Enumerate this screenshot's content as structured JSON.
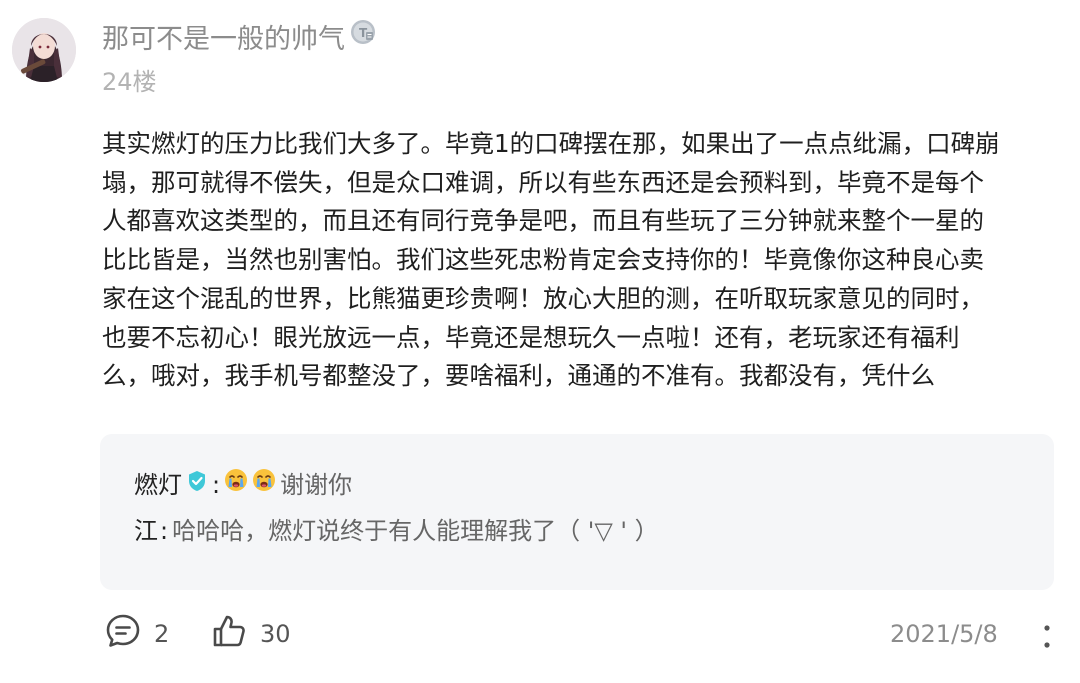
{
  "post": {
    "username": "那可不是一般的帅气",
    "floor": "24楼",
    "content_lines": [
      "其实燃灯的压力比我们大多了。毕竟1的口碑摆在那，如果出了一点点纰漏，口碑崩",
      "塌，那可就得不偿失，但是众口难调，所以有些东西还是会预料到，毕竟不是每个",
      "人都喜欢这类型的，而且还有同行竞争是吧，而且有些玩了三分钟就来整个一星的",
      "比比皆是，当然也别害怕。我们这些死忠粉肯定会支持你的！毕竟像你这种良心卖",
      "家在这个混乱的世界，比熊猫更珍贵啊！放心大胆的测，在听取玩家意见的同时，",
      "也要不忘初心！眼光放远一点，毕竟还是想玩久一点啦！还有，老玩家还有福利",
      "么，哦对，我手机号都整没了，要啥福利，通通的不准有。我都没有，凭什么"
    ]
  },
  "replies": [
    {
      "name": "燃灯",
      "separator": ":",
      "text": "谢谢你"
    },
    {
      "name": "江",
      "separator": ":",
      "text": "哈哈哈，燃灯说终于有人能理解我了（ '▽ ' ）"
    }
  ],
  "footer": {
    "comment_count": "2",
    "like_count": "30",
    "date": "2021/5/8"
  },
  "icons": {
    "level_badge": "level-badge-icon",
    "verified": "verified-badge-icon",
    "emoji": "crying-emoji-icon",
    "comment": "comment-icon",
    "like": "thumbs-up-icon",
    "more": "more-vertical-icon"
  },
  "colors": {
    "username": "#8c8c8c",
    "content": "#1f1f1f",
    "reply_bg": "#f5f6f8",
    "verified": "#3fc8d8"
  }
}
